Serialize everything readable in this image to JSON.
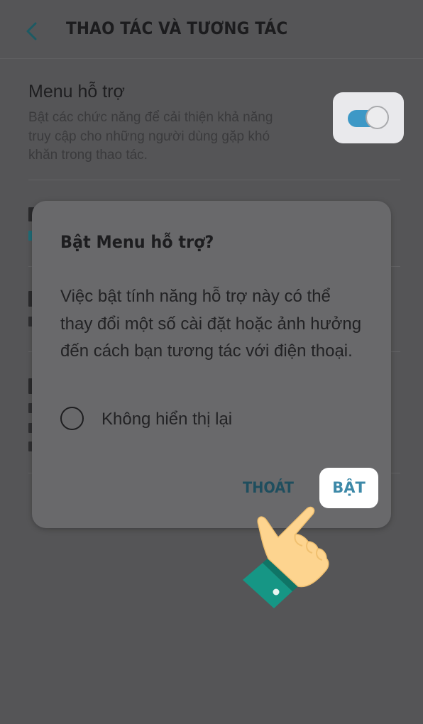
{
  "header": {
    "title": "THAO TÁC VÀ TƯƠNG TÁC",
    "back_icon": "chevron-left-icon"
  },
  "settings": {
    "assistant_menu": {
      "title": "Menu hỗ trợ",
      "description": "Bật các chức năng để cải thiện khả năng truy cập cho những người dùng gặp khó khăn trong thao tác.",
      "toggle_on": true
    }
  },
  "dialog": {
    "title": "Bật Menu hỗ trợ?",
    "body": "Việc bật tính năng hỗ trợ này có thể thay đổi một số cài đặt hoặc ảnh hưởng đến cách bạn tương tác với điện thoại.",
    "checkbox_label": "Không hiển thị lại",
    "checkbox_checked": false,
    "cancel_label": "THOÁT",
    "confirm_label": "BẬT"
  },
  "colors": {
    "background_dim": "#555557",
    "dialog": "#69696b",
    "toggle_track": "#3d98c6",
    "confirm_text": "#3d89a8",
    "hand_skin": "#fdd48f",
    "sleeve": "#169685"
  },
  "overlay_icon": "pointing-hand-icon"
}
